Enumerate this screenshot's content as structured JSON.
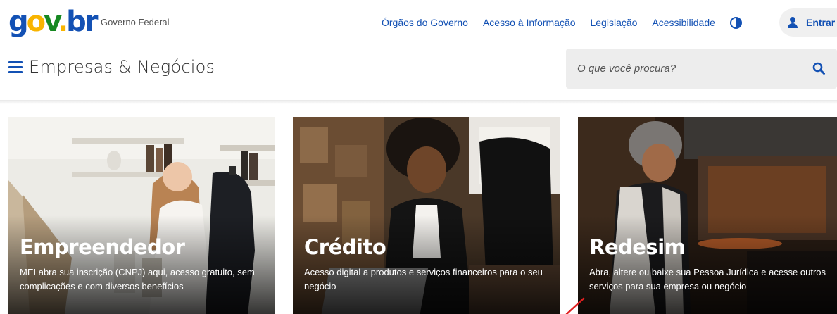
{
  "header": {
    "logo_text": "gov.br",
    "gov_label": "Governo Federal",
    "links": [
      "Órgãos do Governo",
      "Acesso à Informação",
      "Legislação",
      "Acessibilidade"
    ],
    "login_label": "Entrar"
  },
  "site": {
    "title": "Empresas & Negócios"
  },
  "search": {
    "placeholder": "O que você procura?"
  },
  "cards": [
    {
      "title": "Empreendedor",
      "description": "MEI abra sua inscrição (CNPJ) aqui, acesso gratuito, sem complicações e com diversos benefícios"
    },
    {
      "title": "Crédito",
      "description": "Acesso digital a produtos e serviços financeiros para o seu negócio"
    },
    {
      "title": "Redesim",
      "description": "Abra, altere ou baixe sua Pessoa Jurídica e acesse outros serviços para sua empresa ou negócio"
    }
  ],
  "colors": {
    "primary": "#1351b4",
    "logo_yellow": "#f8b400",
    "logo_green": "#168821",
    "annotation_arrow": "#e02020"
  },
  "icons": [
    "menu-icon",
    "contrast-icon",
    "user-icon",
    "search-icon"
  ]
}
